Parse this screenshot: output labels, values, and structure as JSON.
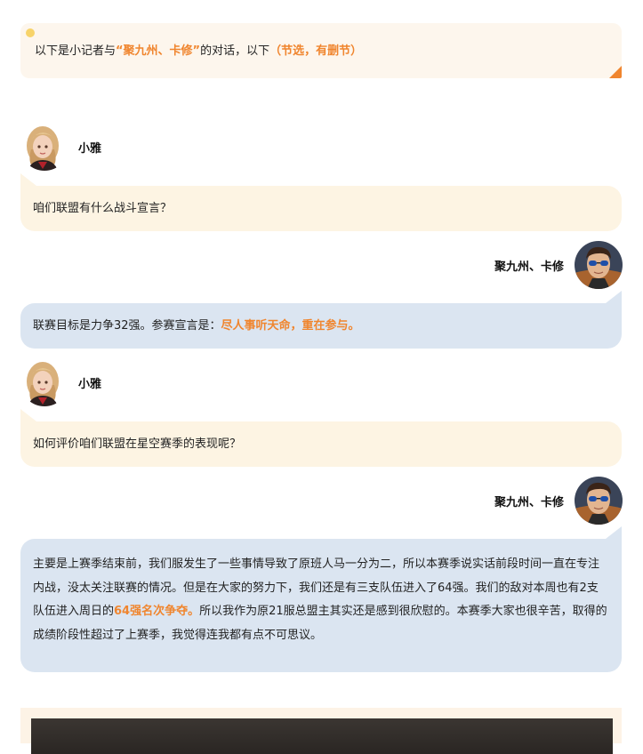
{
  "intro": {
    "prefix": "以下是小记者与",
    "guest": "“聚九州、卡修”",
    "middle": "的对话，以下",
    "note": "（节选，有删节）"
  },
  "speakers": {
    "reporter": "小雅",
    "guest": "聚九州、卡修"
  },
  "messages": [
    {
      "text": "咱们联盟有什么战斗宣言？"
    },
    {
      "prefix": "联赛目标是力争32强。参赛宣言是：",
      "highlight": "尽人事听天命，重在参与。"
    },
    {
      "text": "如何评价咱们联盟在星空赛季的表现呢？"
    },
    {
      "prefix": "主要是上赛季结束前，我们服发生了一些事情导致了原班人马一分为二，所以本赛季说实话前段时间一直在专注内战，没太关注联赛的情况。但是在大家的努力下，我们还是有三支队伍进入了64强。我们的敌对本周也有2支队伍进入周日的",
      "highlight": "64强名次争夺。",
      "suffix": "所以我作为原21服总盟主其实还是感到很欣慰的。本赛季大家也很辛苦，取得的成绩阶段性超过了上赛季，我觉得连我都有点不可思议。"
    }
  ],
  "colors": {
    "accent": "#f0852e",
    "reporter_bubble": "#fdf4e3",
    "guest_bubble": "#dbe5f1",
    "intro_bg": "#fdf6ed"
  },
  "icons": {
    "reporter_avatar": "blonde-girl-avatar",
    "guest_avatar": "sunglasses-man-avatar"
  }
}
